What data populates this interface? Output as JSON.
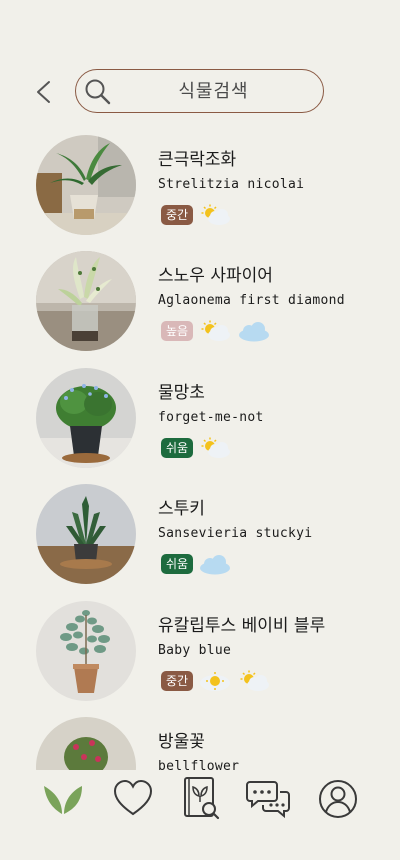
{
  "header": {
    "back_icon": "chevron-left-icon",
    "search_placeholder": "식물검색",
    "search_icon": "search-icon",
    "accent": "#8a5a44"
  },
  "colors": {
    "background": "#f1f0ea",
    "difficulty_medium": "#8a5a44",
    "difficulty_high": "#d9b8b8",
    "difficulty_easy": "#1d6b3e",
    "nav_active": "#7aa35a",
    "nav_inactive": "#3a3a3a"
  },
  "plants": [
    {
      "korean_name": "큰극락조화",
      "scientific_name": "Strelitzia nicolai",
      "difficulty": "중간",
      "difficulty_level": "medium",
      "weather_icons": [
        "partly-sunny-icon"
      ]
    },
    {
      "korean_name": "스노우 사파이어",
      "scientific_name": "Aglaonema first diamond",
      "difficulty": "높음",
      "difficulty_level": "high",
      "weather_icons": [
        "partly-sunny-icon",
        "cloudy-icon"
      ]
    },
    {
      "korean_name": "물망초",
      "scientific_name": "forget-me-not",
      "difficulty": "쉬움",
      "difficulty_level": "easy",
      "weather_icons": [
        "partly-sunny-icon"
      ]
    },
    {
      "korean_name": "스투키",
      "scientific_name": "Sansevieria stuckyi",
      "difficulty": "쉬움",
      "difficulty_level": "easy",
      "weather_icons": [
        "cloudy-icon"
      ]
    },
    {
      "korean_name": "유칼립투스 베이비 블루",
      "scientific_name": "Baby blue",
      "difficulty": "중간",
      "difficulty_level": "medium",
      "weather_icons": [
        "sunny-icon",
        "partly-sunny-icon"
      ]
    },
    {
      "korean_name": "방울꽃",
      "scientific_name": "bellflower",
      "difficulty": "",
      "difficulty_level": "",
      "weather_icons": []
    }
  ],
  "bottom_nav": [
    {
      "icon": "sprout-icon",
      "active": true
    },
    {
      "icon": "heart-icon",
      "active": false
    },
    {
      "icon": "plant-book-icon",
      "active": false
    },
    {
      "icon": "chat-bubbles-icon",
      "active": false
    },
    {
      "icon": "profile-icon",
      "active": false
    }
  ]
}
